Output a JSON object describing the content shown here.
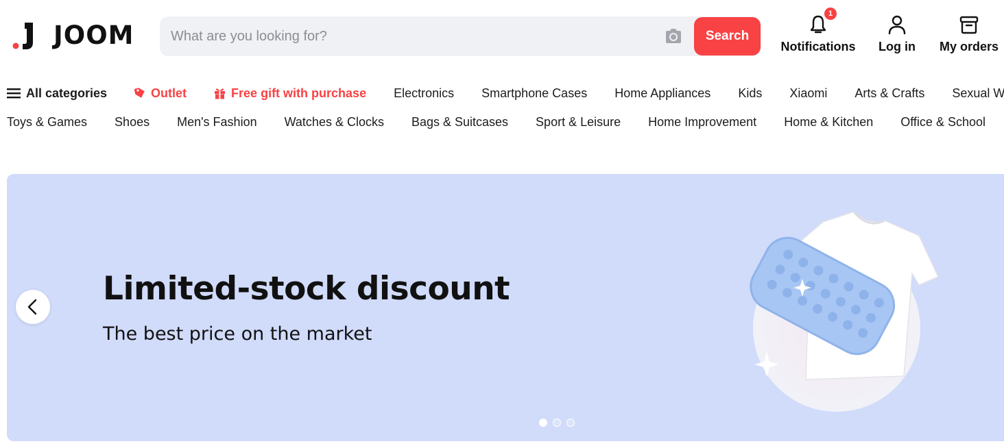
{
  "header": {
    "logo_text": "JOOM",
    "search": {
      "placeholder": "What are you looking for?",
      "button_label": "Search"
    },
    "notifications": {
      "label": "Notifications",
      "count": "1"
    },
    "login_label": "Log in",
    "orders_label": "My orders"
  },
  "nav": {
    "row1": [
      {
        "label": "All categories",
        "icon": "menu-icon",
        "style": "bold"
      },
      {
        "label": "Outlet",
        "icon": "tag-icon",
        "style": "red"
      },
      {
        "label": "Free gift with purchase",
        "icon": "gift-icon",
        "style": "red"
      },
      {
        "label": "Electronics"
      },
      {
        "label": "Smartphone Cases"
      },
      {
        "label": "Home Appliances"
      },
      {
        "label": "Kids"
      },
      {
        "label": "Xiaomi"
      },
      {
        "label": "Arts & Crafts"
      },
      {
        "label": "Sexual Wellness"
      }
    ],
    "row2": [
      {
        "label": "Toys & Games"
      },
      {
        "label": "Shoes"
      },
      {
        "label": "Men's Fashion"
      },
      {
        "label": "Watches & Clocks"
      },
      {
        "label": "Bags & Suitcases"
      },
      {
        "label": "Sport & Leisure"
      },
      {
        "label": "Home Improvement"
      },
      {
        "label": "Home & Kitchen"
      },
      {
        "label": "Office & School"
      }
    ]
  },
  "banner": {
    "title": "Limited-stock discount",
    "subtitle": "The best price on the market",
    "slide_count": 3,
    "active_slide": 1
  },
  "colors": {
    "accent": "#f84244",
    "banner_bg": "#d1dbfa",
    "search_bg": "#f0f1f4"
  }
}
